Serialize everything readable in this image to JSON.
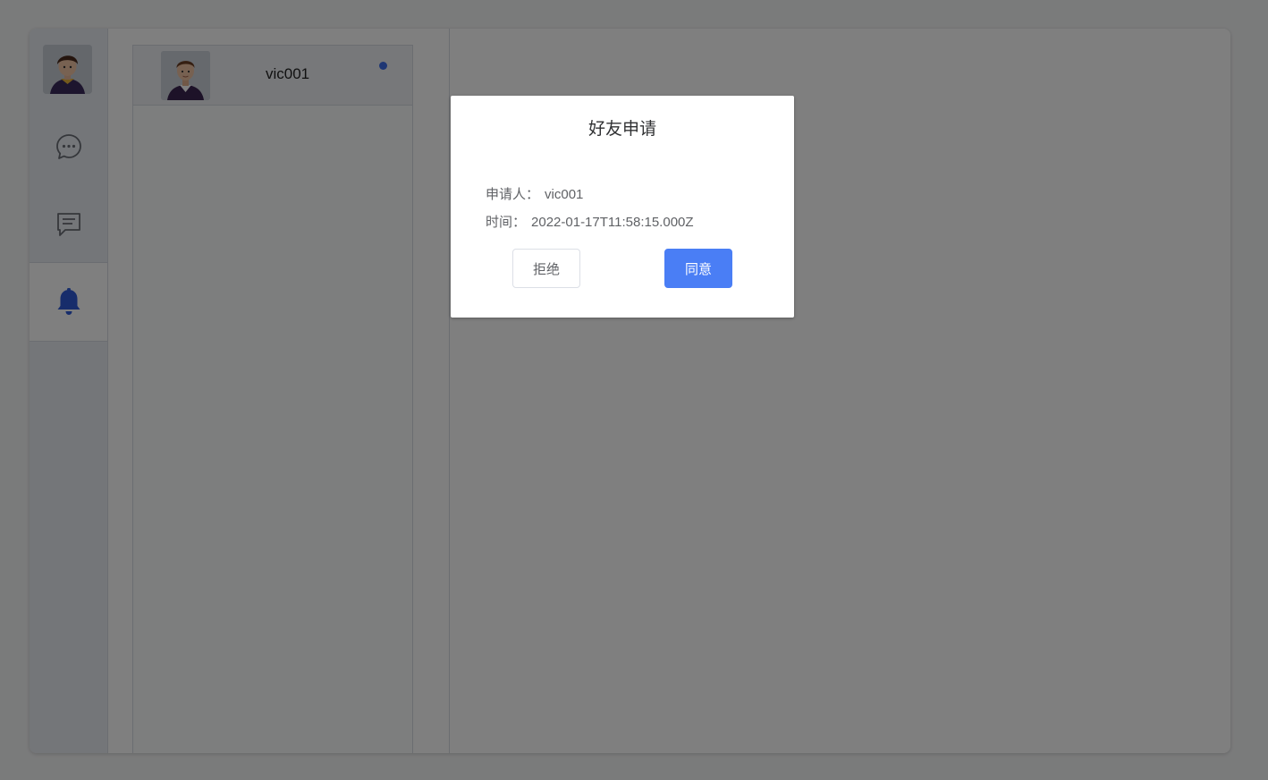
{
  "sidebar": {
    "avatar_icon": "user-avatar",
    "nav": [
      {
        "icon": "chat-bubble-icon",
        "active": false
      },
      {
        "icon": "message-list-icon",
        "active": false
      },
      {
        "icon": "bell-icon",
        "active": true
      }
    ]
  },
  "friend_list": {
    "items": [
      {
        "name": "vic001",
        "unread": true
      }
    ]
  },
  "dialog": {
    "title": "好友申请",
    "applicant_label": "申请人：",
    "applicant_value": "vic001",
    "time_label": "时间：",
    "time_value": "2022-01-17T11:58:15.000Z",
    "reject_label": "拒绝",
    "accept_label": "同意"
  },
  "colors": {
    "accent": "#4a7ef5",
    "active_icon": "#2f5bd6",
    "unread_dot": "#3f6ee8"
  }
}
